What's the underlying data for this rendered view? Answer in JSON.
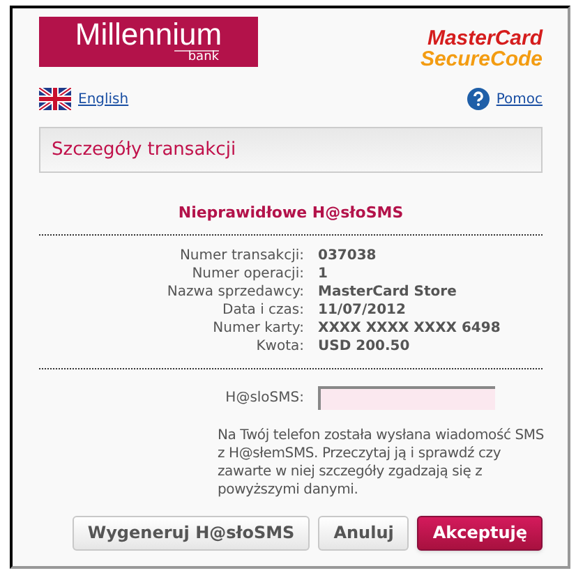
{
  "header": {
    "bank_logo": {
      "name": "Millennium",
      "sub": "bank"
    },
    "card_logo": {
      "line1": "MasterCard",
      "line2": "SecureCode"
    }
  },
  "links": {
    "language": "English",
    "help": "Pomoc"
  },
  "section_title": "Szczegóły transakcji",
  "error_message": "Nieprawidłowe H@słoSMS",
  "details": [
    {
      "label": "Numer transakcji:",
      "value": "037038"
    },
    {
      "label": "Numer operacji:",
      "value": "1"
    },
    {
      "label": "Nazwa sprzedawcy:",
      "value": "MasterCard Store"
    },
    {
      "label": "Data i czas:",
      "value": "11/07/2012"
    },
    {
      "label": "Numer karty:",
      "value": "XXXX XXXX XXXX 6498"
    },
    {
      "label": "Kwota:",
      "value": "USD 200.50"
    }
  ],
  "sms_field": {
    "label": "H@sloSMS:"
  },
  "info_text": "Na Twój telefon została wysłana wiadomość SMS z H@słemSMS. Przeczytaj ją i sprawdź czy zawarte w niej szczegóły zgadzają się z powyższymi danymi.",
  "buttons": [
    {
      "label": "Wygeneruj H@słoSMS",
      "kind": "secondary"
    },
    {
      "label": "Anuluj",
      "kind": "secondary"
    },
    {
      "label": "Akceptuję",
      "kind": "primary"
    }
  ]
}
